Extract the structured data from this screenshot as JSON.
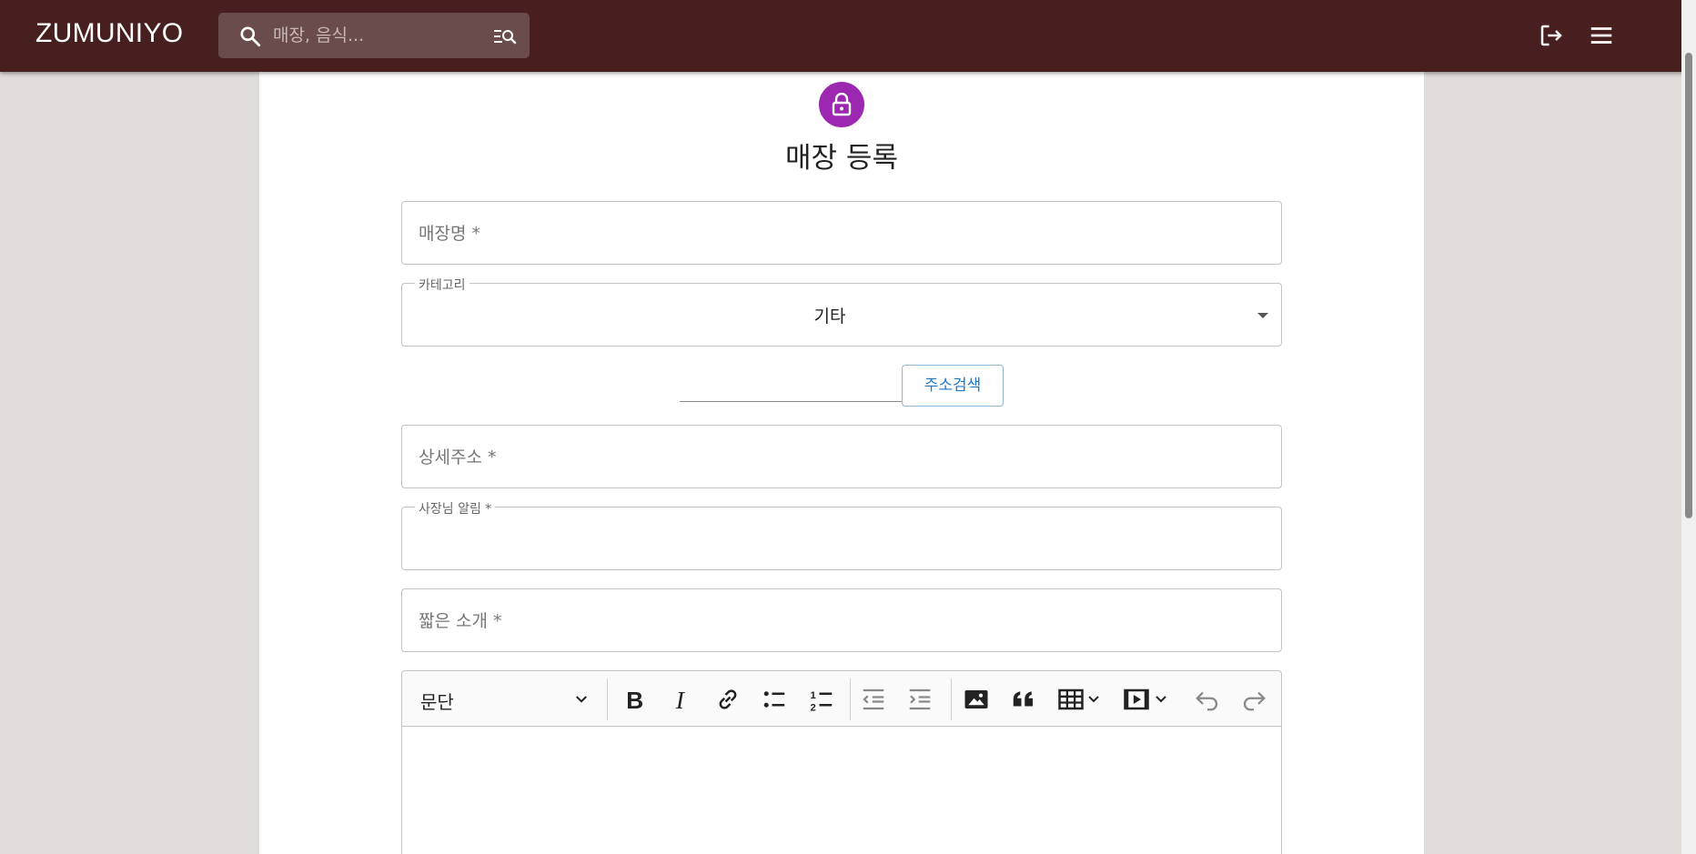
{
  "appbar": {
    "brand": "ZUMUNIYO",
    "search_placeholder": "매장, 음식..."
  },
  "form": {
    "title": "매장 등록",
    "store_name_label": "매장명 *",
    "category_label": "카테고리",
    "category_value": "기타",
    "address_search_button": "주소검색",
    "detail_address_label": "상세주소 *",
    "owner_notice_label": "사장님 알림 *",
    "short_intro_label": "짧은 소개 *"
  },
  "editor": {
    "paragraph_style": "문단"
  },
  "colors": {
    "appbar": "#471f1f",
    "avatar": "#9c27b0",
    "accent_button": "#1f78c8"
  }
}
